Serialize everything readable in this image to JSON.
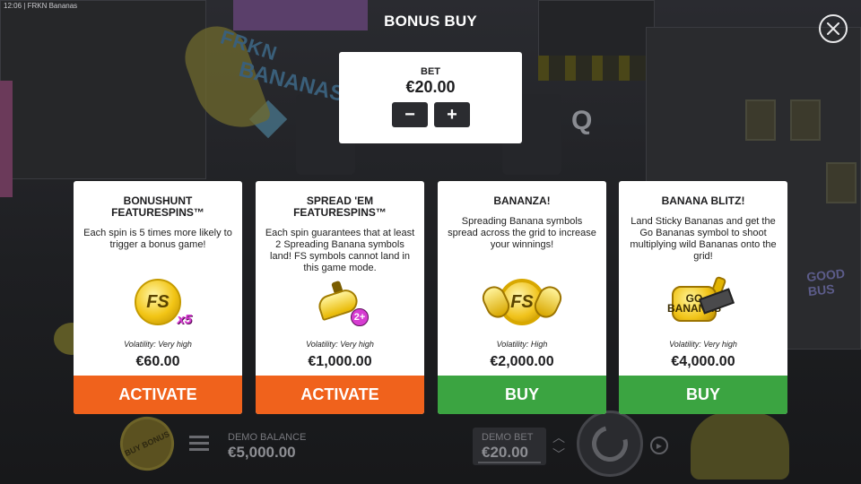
{
  "status_bar": {
    "time": "12:06",
    "separator": "|",
    "app_name": "FRKN Bananas"
  },
  "header": {
    "title": "BONUS BUY",
    "close_icon": "close-icon"
  },
  "bet_panel": {
    "label": "BET",
    "value": "€20.00",
    "minus_label": "−",
    "plus_label": "+"
  },
  "cards": [
    {
      "title": "BONUSHUNT FEATURESPINS™",
      "description": "Each spin is 5 times more likely to trigger a bonus game!",
      "art_icon": "fs-x5-coin-icon",
      "art_text": "FS",
      "art_badge": "x5",
      "volatility": "Volatility: Very high",
      "price": "€60.00",
      "action": "ACTIVATE",
      "action_color": "#f0621c"
    },
    {
      "title": "SPREAD 'EM FEATURESPINS™",
      "description": "Each spin guarantees that at least 2 Spreading Banana symbols land! FS symbols cannot land in this game mode.",
      "art_icon": "banana-2plus-icon",
      "art_badge": "2+",
      "volatility": "Volatility: Very high",
      "price": "€1,000.00",
      "action": "ACTIVATE",
      "action_color": "#f0621c"
    },
    {
      "title": "BANANZA!",
      "description": "Spreading Banana symbols spread across the grid to increase your winnings!",
      "art_icon": "fs-banana-coin-icon",
      "art_text": "FS",
      "volatility": "Volatility: High",
      "price": "€2,000.00",
      "action": "BUY",
      "action_color": "#3ba441"
    },
    {
      "title": "BANANA BLITZ!",
      "description": "Land Sticky Bananas and get the Go Bananas symbol to shoot multiplying wild Bananas onto the grid!",
      "art_icon": "go-bananas-icon",
      "art_text": "GO BANANAS",
      "volatility": "Volatility: Very high",
      "price": "€4,000.00",
      "action": "BUY",
      "action_color": "#3ba441"
    }
  ],
  "background": {
    "logo_text_1": "FRKN",
    "logo_text_2": "BANANAS",
    "logo_tm": "TM",
    "graffiti": "GOOD BUS",
    "reel_letter": "Q"
  },
  "bottom_bar": {
    "buy_bonus_label": "BUY BONUS",
    "demo_balance_label": "DEMO BALANCE",
    "demo_balance_value": "€5,000.00",
    "demo_bet_label": "DEMO BET",
    "demo_bet_value": "€20.00"
  }
}
